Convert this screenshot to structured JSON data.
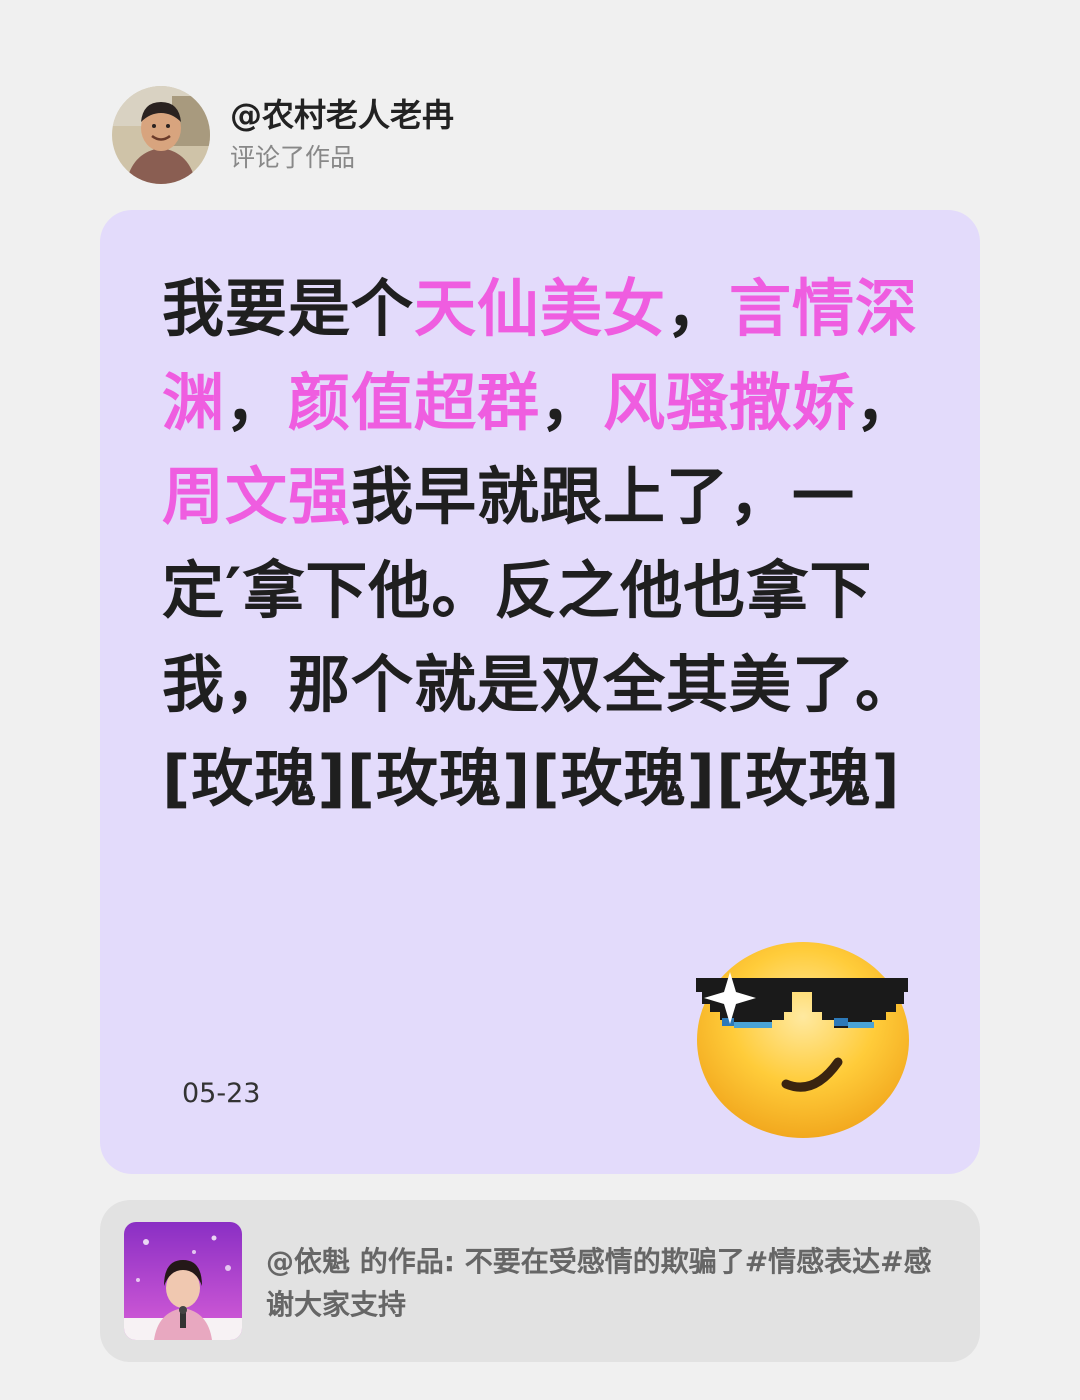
{
  "header": {
    "username": "@农村老人老冉",
    "action": "评论了作品"
  },
  "comment": {
    "seg1": "我要是个",
    "seg2": "天仙美女",
    "seg3": "，",
    "seg4": "言情深渊",
    "seg5": "，",
    "seg6": "颜值超群",
    "seg7": "，",
    "seg8": "风骚撒娇",
    "seg9": "，",
    "seg10": "周文强",
    "seg11": "我早就跟上了，一定′拿下他。反之他也拿下我，那个就是双全其美了。[玫瑰][玫瑰][玫瑰][玫瑰]",
    "date": "05-23"
  },
  "source": {
    "text": "@依魁 的作品: 不要在受感情的欺骗了#情感表达#感谢大家支持"
  },
  "colors": {
    "background": "#f0f0f0",
    "card": "#e3dbfb",
    "highlight": "#ef5de0",
    "source_bar": "#e2e2e2"
  },
  "icons": {
    "emoji": "sunglasses-face-icon"
  }
}
